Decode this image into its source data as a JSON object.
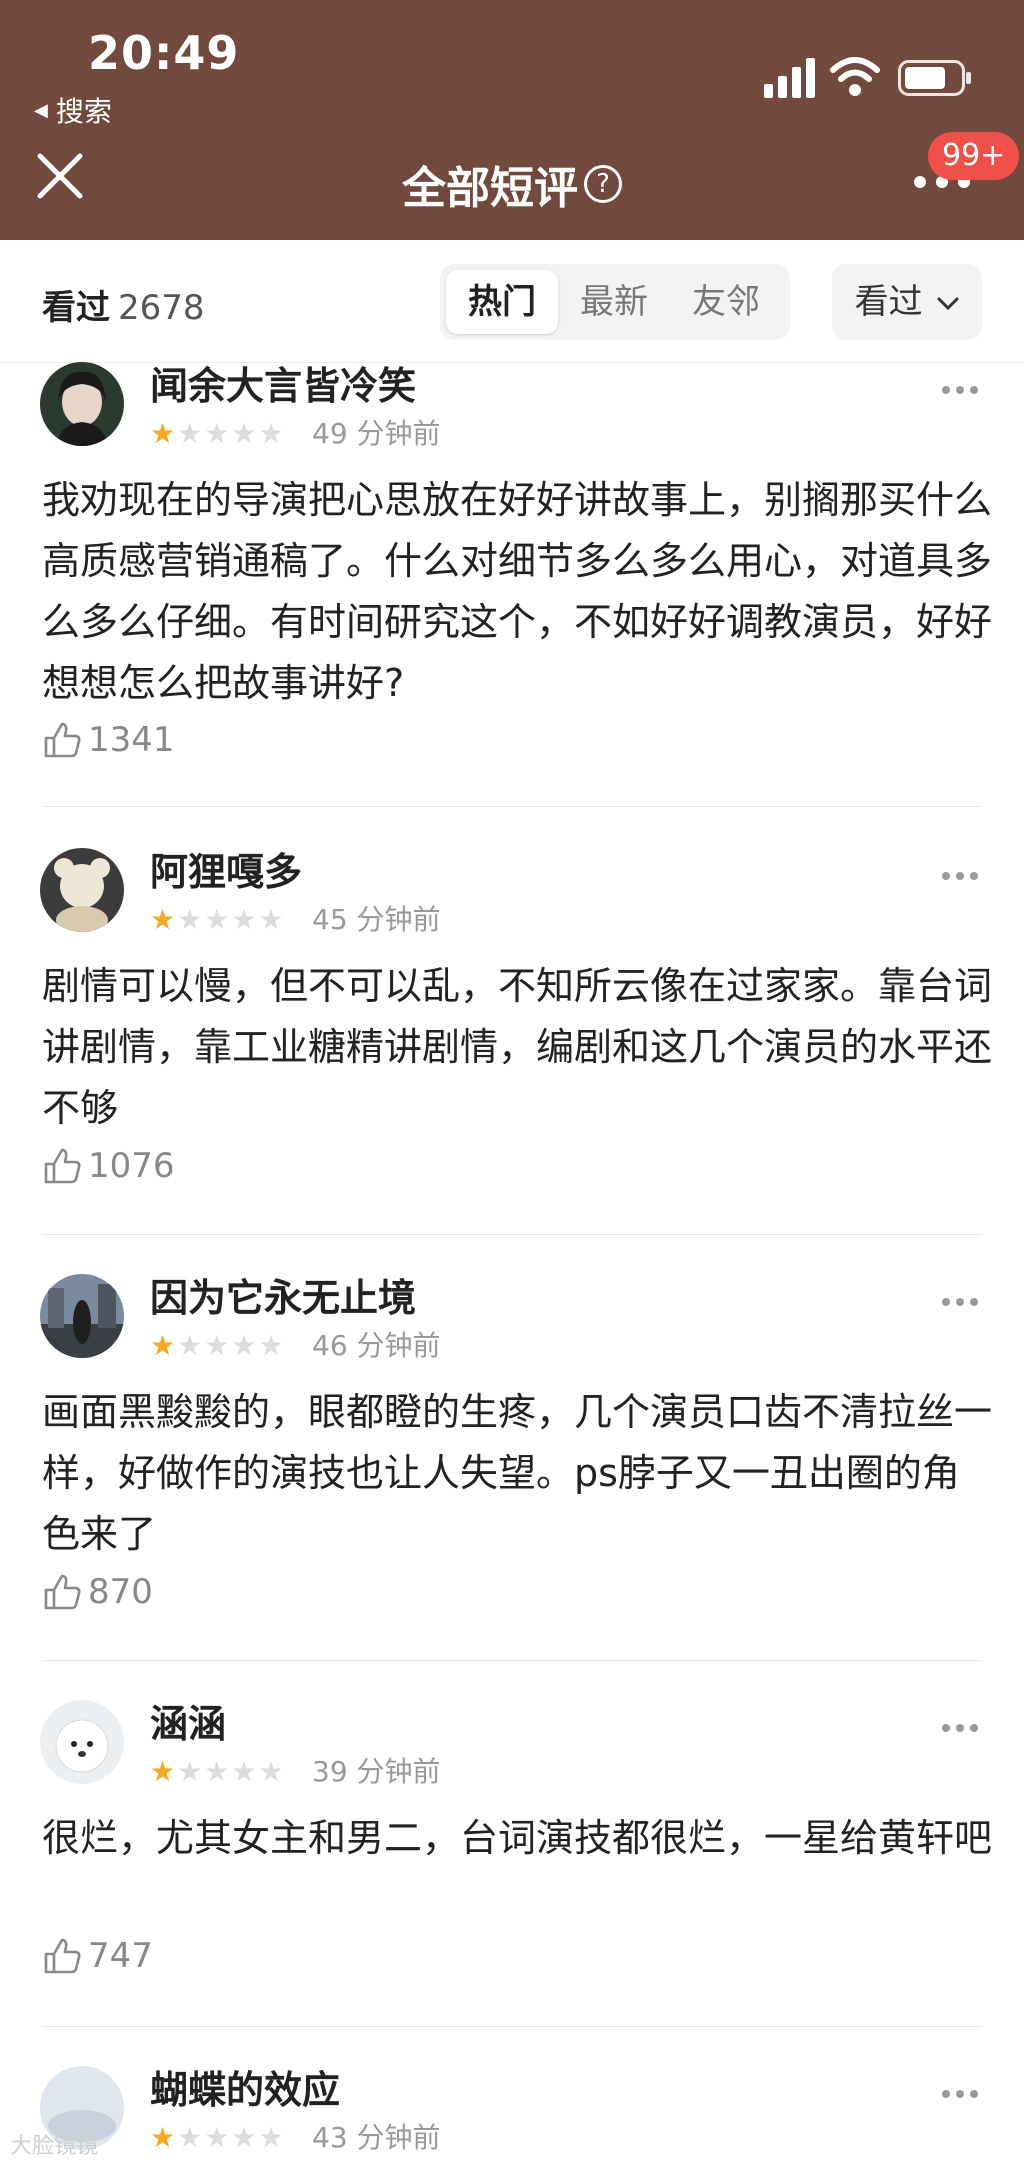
{
  "status_bar": {
    "time": "20:49",
    "back_app": "搜索"
  },
  "header": {
    "title": "全部短评",
    "badge": "99+"
  },
  "filter": {
    "seen_label": "看过",
    "seen_count": "2678",
    "tabs": [
      {
        "label": "热门",
        "active": true
      },
      {
        "label": "最新",
        "active": false
      },
      {
        "label": "友邻",
        "active": false
      }
    ],
    "dropdown": "看过"
  },
  "comments": [
    {
      "user": "闻余大言皆冷笑",
      "rating": 1,
      "time": "49 分钟前",
      "text": "我劝现在的导演把心思放在好好讲故事上，别搁那买什么高质感营销通稿了。什么对细节多么多么用心，对道具多么多么仔细。有时间研究这个，不如好好调教演员，好好想想怎么把故事讲好?",
      "likes": "1341"
    },
    {
      "user": "阿狸嘎多",
      "rating": 1,
      "time": "45 分钟前",
      "text": "剧情可以慢，但不可以乱，不知所云像在过家家。靠台词讲剧情，靠工业糖精讲剧情，编剧和这几个演员的水平还不够",
      "likes": "1076"
    },
    {
      "user": "因为它永无止境",
      "rating": 1,
      "time": "46 分钟前",
      "text": "画面黑黢黢的，眼都瞪的生疼，几个演员口齿不清拉丝一样，好做作的演技也让人失望。ps脖子又一丑出圈的角色来了",
      "likes": "870"
    },
    {
      "user": "涵涵",
      "rating": 1,
      "time": "39 分钟前",
      "text": "很烂，尤其女主和男二，台词演技都很烂，一星给黄轩吧",
      "likes": "747"
    },
    {
      "user": "蝴蝶的效应",
      "rating": 1,
      "time": "43 分钟前",
      "text": "",
      "likes": ""
    }
  ],
  "watermark": "大脸镜镜",
  "colors": {
    "header_bg": "#71493d",
    "star": "#f5a623",
    "badge": "#f0504a"
  }
}
